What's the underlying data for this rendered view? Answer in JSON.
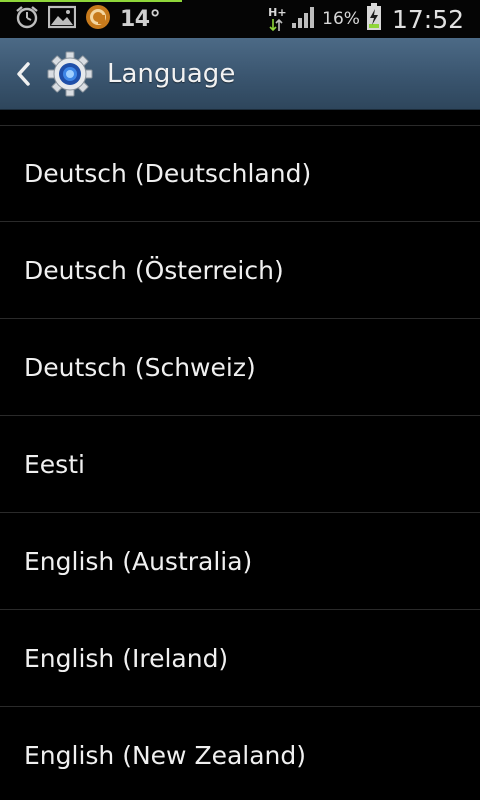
{
  "status_bar": {
    "temperature": "14°",
    "network_type": "H+",
    "battery_percent": "16%",
    "clock": "17:52",
    "icons": [
      "alarm-icon",
      "gallery-icon",
      "weather-app-icon",
      "data-transfer-icon",
      "signal-icon",
      "battery-charging-icon"
    ],
    "accent_color": "#8fd63a"
  },
  "action_bar": {
    "title": "Language",
    "back_icon": "chevron-left-icon",
    "app_icon": "settings-gear-icon",
    "background_color": "#3a556f"
  },
  "languages": [
    "Deutsch (Deutschland)",
    "Deutsch (Österreich)",
    "Deutsch (Schweiz)",
    "Eesti",
    "English (Australia)",
    "English (Ireland)",
    "English (New Zealand)"
  ]
}
